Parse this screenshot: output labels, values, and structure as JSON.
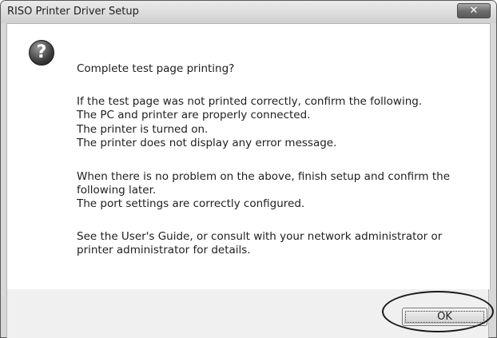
{
  "window": {
    "title": "RISO Printer Driver Setup",
    "close_label": "✕"
  },
  "dialog": {
    "icon": "question-icon",
    "question": "Complete test page printing?",
    "lines": [
      "If the test page was not printed correctly, confirm the following.",
      " The PC and printer are properly connected.",
      " The printer is turned on.",
      " The printer does not display any error message.",
      "When there is no problem on the above, finish setup and confirm the",
      "following later.",
      " The port settings are correctly configured.",
      "See the User's Guide, or consult with your network administrator or",
      "printer administrator for details."
    ]
  },
  "buttons": {
    "ok_label": "OK"
  }
}
